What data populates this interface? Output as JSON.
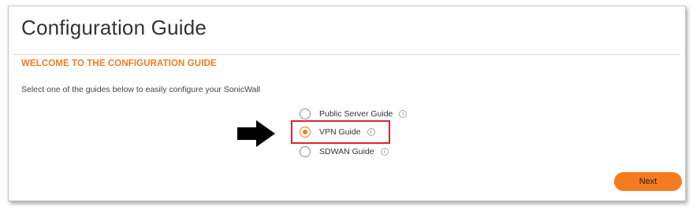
{
  "header": {
    "title": "Configuration Guide"
  },
  "section": {
    "heading": "WELCOME TO THE CONFIGURATION GUIDE",
    "intro": "Select one of the guides below to easily configure your SonicWall"
  },
  "guides": [
    {
      "label": "Public Server Guide",
      "selected": false,
      "info_icon": "info-icon"
    },
    {
      "label": "VPN Guide",
      "selected": true,
      "info_icon": "info-icon"
    },
    {
      "label": "SDWAN Guide",
      "selected": false,
      "info_icon": "info-icon"
    }
  ],
  "footer": {
    "next_label": "Next"
  },
  "colors": {
    "accent": "#f47b20",
    "highlight": "#d9262c",
    "arrow": "#000000"
  },
  "info_glyph": "i"
}
